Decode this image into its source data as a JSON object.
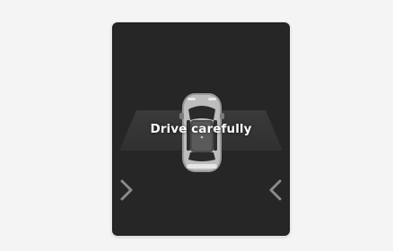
{
  "display": {
    "message": "Drive carefully"
  },
  "icons": {
    "left_indicator": "chevron-right-icon",
    "right_indicator": "chevron-left-icon",
    "vehicle": "car-top-view-icon"
  },
  "colors": {
    "panel_background": "#262626",
    "floor_zone": "#3d3d3d",
    "indicator": "#8a8a8a",
    "message_text": "#ffffff"
  }
}
